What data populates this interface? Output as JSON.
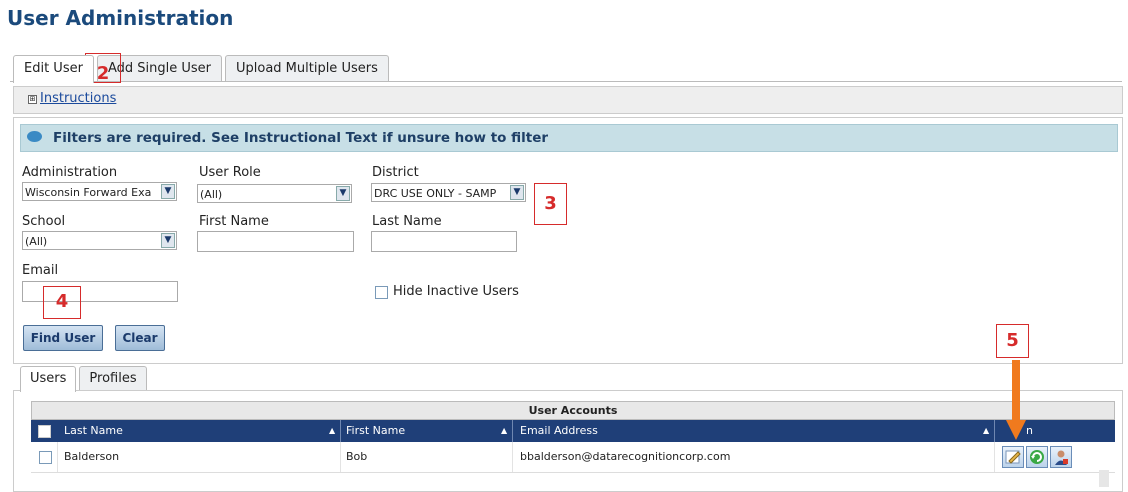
{
  "page_title": "User Administration",
  "tabs": [
    {
      "label": "Edit User",
      "active": true
    },
    {
      "label": "Add Single User",
      "active": false
    },
    {
      "label": "Upload Multiple Users",
      "active": false
    }
  ],
  "instructions": {
    "link": "Instructions",
    "expand_glyph": "⊞"
  },
  "filters": {
    "banner": "Filters are required. See Instructional Text if unsure how to filter",
    "administration": {
      "label": "Administration",
      "value": "Wisconsin Forward Exa"
    },
    "user_role": {
      "label": "User Role",
      "value": "(All)"
    },
    "district": {
      "label": "District",
      "value": "DRC USE ONLY - SAMP"
    },
    "school": {
      "label": "School",
      "value": "(All)"
    },
    "first_name": {
      "label": "First Name",
      "value": ""
    },
    "last_name": {
      "label": "Last Name",
      "value": ""
    },
    "email": {
      "label": "Email",
      "value": ""
    },
    "hide_inactive": {
      "label": "Hide Inactive Users",
      "checked": false
    },
    "find_button": "Find User",
    "clear_button": "Clear"
  },
  "markers": {
    "m2": "2",
    "m3": "3",
    "m4": "4",
    "m5": "5"
  },
  "subtabs": [
    {
      "label": "Users",
      "active": true
    },
    {
      "label": "Profiles",
      "active": false
    }
  ],
  "grid": {
    "title": "User Accounts",
    "columns": [
      "Last Name",
      "First Name",
      "Email Address",
      "Action"
    ],
    "action_visible": "n",
    "rows": [
      {
        "last_name": "Balderson",
        "first_name": "Bob",
        "email": "bbalderson@datarecognitioncorp.com"
      }
    ]
  },
  "colors": {
    "accent": "#1f3f78",
    "marker": "#d62b2b",
    "arrow": "#f07a1e"
  }
}
